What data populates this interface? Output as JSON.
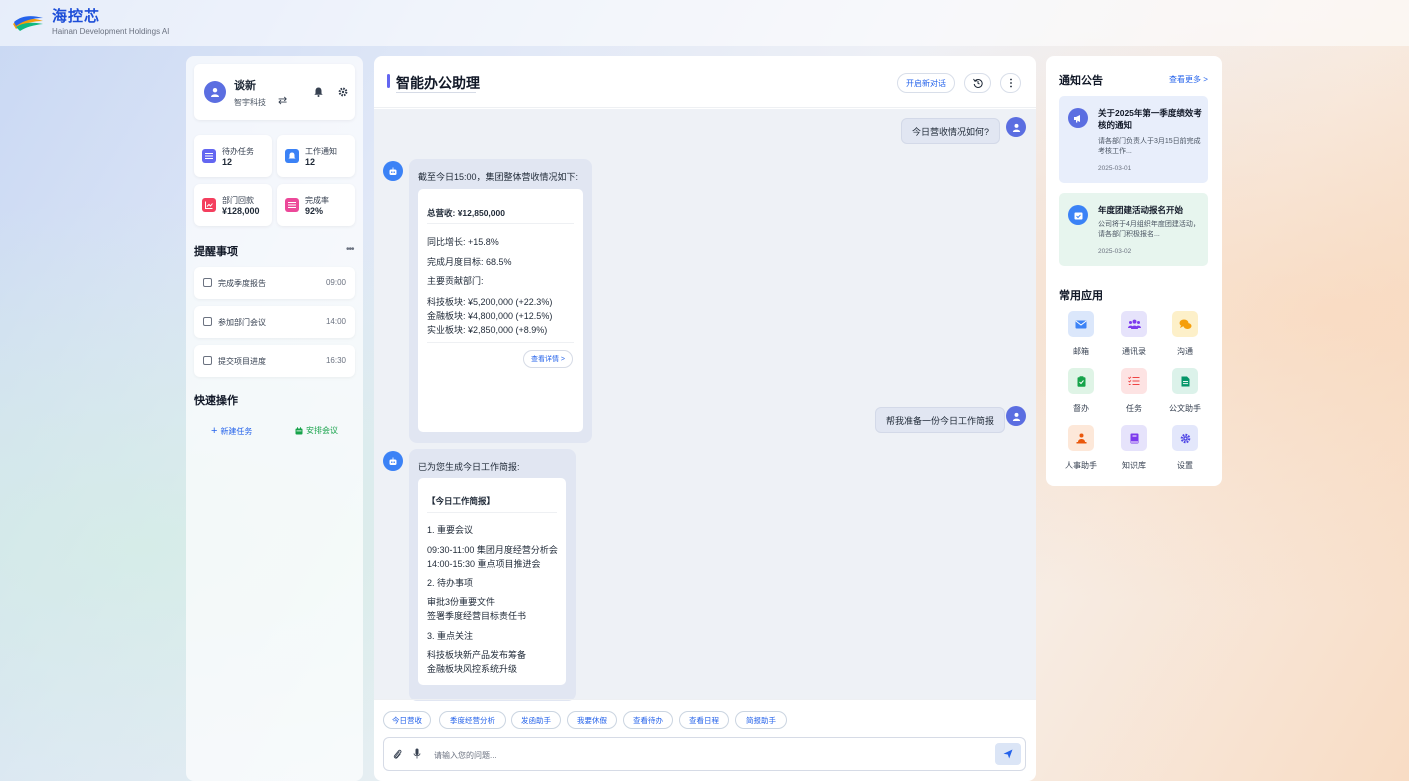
{
  "brand": {
    "name": "海控芯",
    "sub": "Hainan Development Holdings AI"
  },
  "user": {
    "name": "谈新",
    "org": "智宇科技"
  },
  "stats": [
    {
      "label": "待办任务",
      "value": "12"
    },
    {
      "label": "工作通知",
      "value": "12"
    },
    {
      "label": "部门回款",
      "value": "¥128,000"
    },
    {
      "label": "完成率",
      "value": "92%"
    }
  ],
  "reminders": {
    "title": "提醒事项",
    "items": [
      {
        "text": "完成季度报告",
        "time": "09:00"
      },
      {
        "text": "参加部门会议",
        "time": "14:00"
      },
      {
        "text": "提交项目进度",
        "time": "16:30"
      }
    ]
  },
  "quick": {
    "title": "快速操作",
    "new_task": "新建任务",
    "schedule": "安排会议"
  },
  "center": {
    "title": "智能办公助理",
    "new_chat": "开启新对话",
    "messages": {
      "q1": "今日营收情况如何?",
      "a1_lead": "截至今日15:00，集团整体营收情况如下:",
      "a1_rows": [
        "总营收: ¥12,850,000",
        "同比增长: +15.8%",
        "完成月度目标: 68.5%",
        "主要贡献部门:",
        "科技板块: ¥5,200,000 (+22.3%)",
        "金融板块: ¥4,800,000 (+12.5%)",
        "实业板块: ¥2,850,000 (+8.9%)"
      ],
      "a1_detail": "查看详情 >",
      "q2": "帮我准备一份今日工作简报",
      "a2_lead": "已为您生成今日工作简报:",
      "a2_rows": [
        "【今日工作简报】",
        "1. 重要会议",
        "09:30-11:00 集团月度经营分析会",
        "14:00-15:30 重点项目推进会",
        "2. 待办事项",
        "审批3份重要文件",
        "签署季度经营目标责任书",
        "3. 重点关注",
        "科技板块新产品发布筹备",
        "金融板块风控系统升级"
      ]
    },
    "chips": [
      "今日营收",
      "季度经营分析",
      "发函助手",
      "我要休假",
      "查看待办",
      "查看日程",
      "简报助手"
    ],
    "input_placeholder": "请输入您的问题..."
  },
  "right": {
    "notices_title": "通知公告",
    "more": "查看更多 >",
    "notices": [
      {
        "title": "关于2025年第一季度绩效考核的通知",
        "desc": "请各部门负责人于3月15日前完成考核工作...",
        "date": "2025-03-01"
      },
      {
        "title": "年度团建活动报名开始",
        "desc": "公司将于4月组织年度团建活动，请各部门积极报名...",
        "date": "2025-03-02"
      }
    ],
    "apps_title": "常用应用",
    "apps": [
      "邮箱",
      "通讯录",
      "沟通",
      "督办",
      "任务",
      "公文助手",
      "人事助手",
      "知识库",
      "设置"
    ]
  }
}
